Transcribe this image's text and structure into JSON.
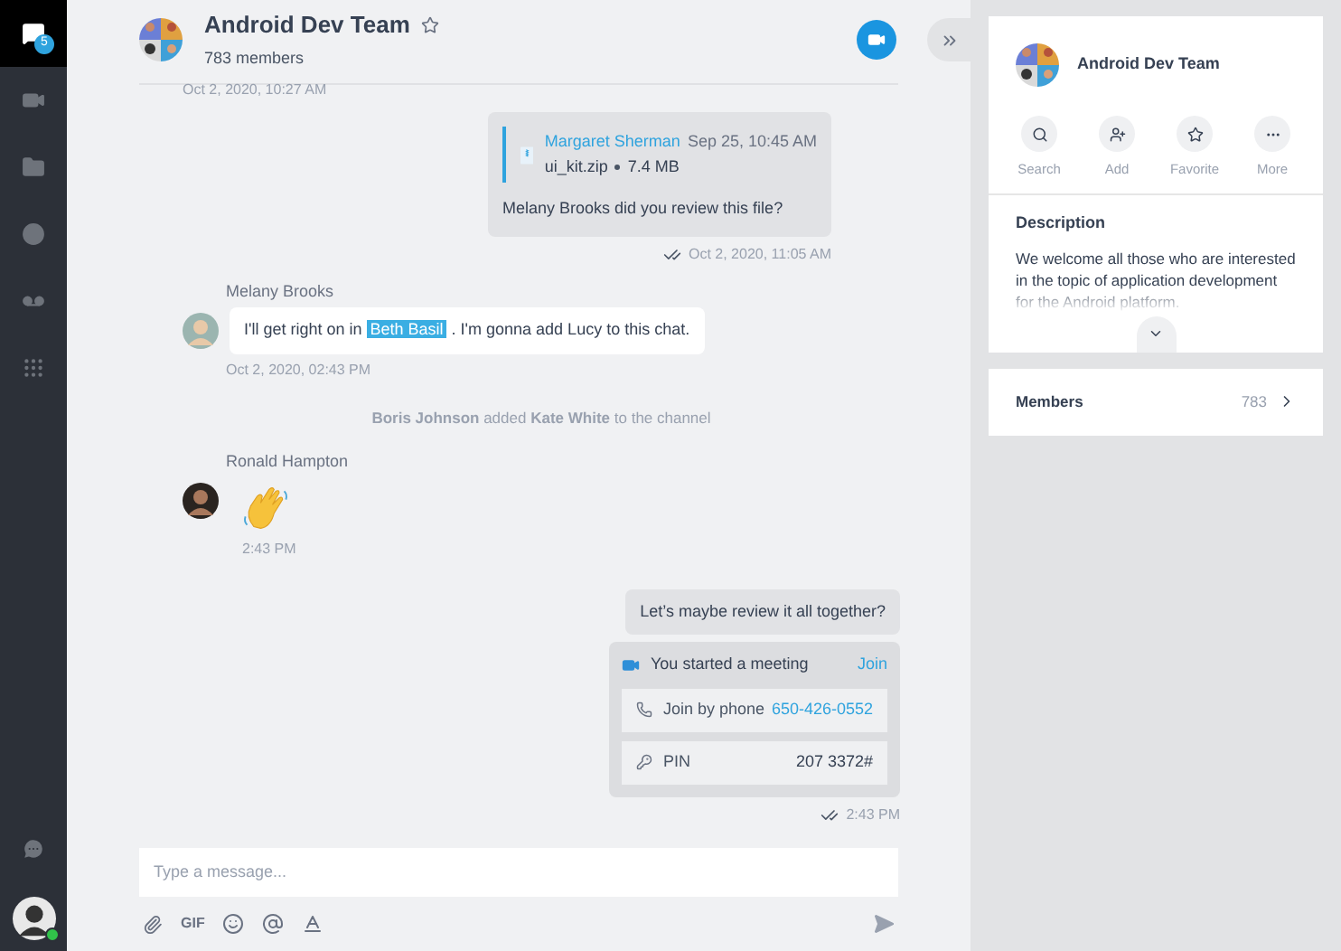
{
  "sidebar": {
    "badge": "5",
    "items": [
      {
        "kind": "chats",
        "selected": true
      },
      {
        "kind": "calls",
        "selected": false
      },
      {
        "kind": "files",
        "selected": false
      },
      {
        "kind": "history",
        "selected": false
      },
      {
        "kind": "voicemail",
        "selected": false
      },
      {
        "kind": "apps",
        "selected": false
      }
    ],
    "status": {
      "online": true
    }
  },
  "header": {
    "title": "Android Dev Team",
    "subtitle": "783 members",
    "favorite": false
  },
  "messages": [
    {
      "kind": "time",
      "time": "Oct 2, 2020, 10:27 AM"
    },
    {
      "kind": "file",
      "author": "Margaret Sherman",
      "date": "Sep 25, 10:45 AM",
      "file": "ui_kit.zip",
      "size": "7.4 MB",
      "text": "Melany Brooks did you review this file?",
      "time": "Oct 2, 2020, 11:05 AM",
      "read": true
    },
    {
      "kind": "text",
      "author": "Melany Brooks",
      "before": "I'll get right on in ",
      "mention": "Beth Basil",
      "after": " . I'm gonna add Lucy to this chat.",
      "time": "Oct 2, 2020, 02:43 PM"
    },
    {
      "kind": "system",
      "text": "**Boris Johnson** added **Kate White** to the channel"
    },
    {
      "kind": "emoji",
      "author": "Ronald Hampton",
      "time": "2:43 PM"
    },
    {
      "kind": "own_text",
      "text": "Let’s maybe review it all together?"
    },
    {
      "kind": "meeting",
      "title": "You started a meeting",
      "action": "Join",
      "rows": [
        {
          "kind": "phone",
          "label": "Join by phone",
          "value": "650-426-0552"
        },
        {
          "kind": "pin",
          "label": "PIN",
          "value": "207 3372#"
        }
      ],
      "time": "2:43 PM",
      "read": true
    }
  ],
  "composer": {
    "placeholder": "Type a message...",
    "gif": "GIF"
  },
  "details": {
    "title": "Android Dev Team",
    "actions": [
      {
        "kind": "search",
        "label": "Search"
      },
      {
        "kind": "add",
        "label": "Add"
      },
      {
        "kind": "favorite",
        "label": "Favorite"
      },
      {
        "kind": "more",
        "label": "More"
      }
    ],
    "description_heading": "Description",
    "description": "We welcome all those who are interested in the topic of application development for the Android platform.",
    "members_label": "Members",
    "members_count": "783"
  }
}
